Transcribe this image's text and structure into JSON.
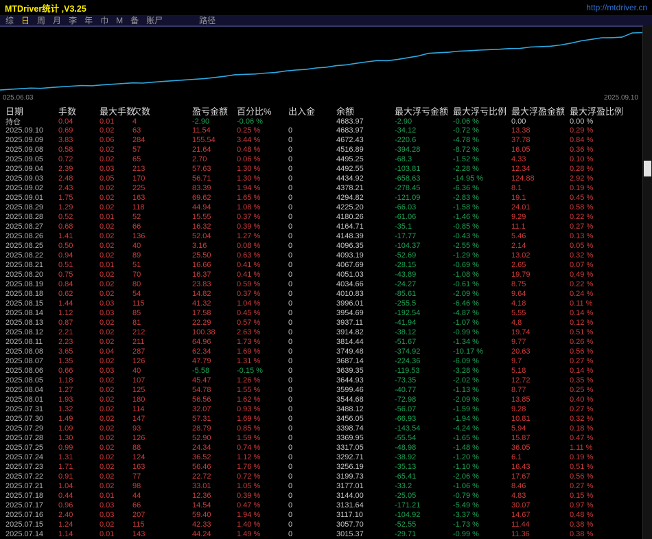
{
  "titlebar": {
    "title": "MTDriver统计 ,V3.25",
    "link": "http://mtdriver.cn"
  },
  "menu": {
    "items": [
      {
        "label": "综",
        "active": false,
        "spaced": false
      },
      {
        "label": "日",
        "active": true,
        "spaced": false
      },
      {
        "label": "周",
        "active": false,
        "spaced": false
      },
      {
        "label": "月",
        "active": false,
        "spaced": false
      },
      {
        "label": "李",
        "active": false,
        "spaced": false
      },
      {
        "label": "年",
        "active": false,
        "spaced": false
      },
      {
        "label": "巾",
        "active": false,
        "spaced": false
      },
      {
        "label": "M",
        "active": false,
        "spaced": false
      },
      {
        "label": "备",
        "active": false,
        "spaced": false
      },
      {
        "label": "账尸",
        "active": false,
        "spaced": false
      },
      {
        "label": "路径",
        "active": false,
        "spaced": true
      }
    ]
  },
  "colors": {
    "red": "#d03c3c",
    "green": "#1ea355",
    "white": "#c8c8c8",
    "date_gray": "#b4b4b4",
    "header": "#d6d6d6",
    "line_blue": "#2da9e1",
    "title_yellow": "#ffef00",
    "link_blue": "#2f6fd0"
  },
  "chart_data": {
    "type": "line",
    "title": "",
    "xlabel": "",
    "ylabel": "",
    "x_start_label": "025.06.03",
    "x_end_label": "2025.09.10",
    "ylim": [
      2450,
      4800
    ],
    "legend": "none",
    "grid": false,
    "estimated_prefix_count": 21,
    "series": [
      {
        "name": "余额",
        "color": "#2da9e1",
        "values": [
          2550,
          2575,
          2598,
          2620,
          2612,
          2645,
          2670,
          2692,
          2715,
          2708,
          2738,
          2765,
          2790,
          2815,
          2808,
          2840,
          2868,
          2895,
          2920,
          2948,
          2971,
          3015.37,
          3057.7,
          3117.1,
          3131.64,
          3144.0,
          3177.01,
          3199.73,
          3256.19,
          3292.71,
          3317.05,
          3369.95,
          3398.74,
          3456.05,
          3488.12,
          3544.68,
          3599.46,
          3644.93,
          3639.35,
          3687.14,
          3749.48,
          3814.44,
          3914.82,
          3937.11,
          3954.69,
          3996.01,
          4010.83,
          4034.66,
          4051.03,
          4067.69,
          4093.19,
          4096.35,
          4148.39,
          4164.71,
          4180.26,
          4225.2,
          4294.82,
          4378.21,
          4434.92,
          4492.55,
          4495.25,
          4516.89,
          4672.43,
          4683.97
        ]
      }
    ]
  },
  "table": {
    "columns": [
      "日期",
      "手数",
      "最大手数",
      "欠数",
      "盈亏金额",
      "百分比%",
      "出入金",
      "余额",
      "最大浮亏金额",
      "最大浮亏比例",
      "最大浮盈金额",
      "最大浮盈比例"
    ],
    "position_row": [
      "持仓",
      "0.04",
      "0.01",
      "4",
      "-2.90",
      "-0.06 %",
      "",
      "4683.97",
      "-2.90",
      "-0.06 %",
      "0.00",
      "0.00 %"
    ],
    "rows": [
      [
        "2025.09.10",
        "0.69",
        "0.02",
        "63",
        "11.54",
        "0.25 %",
        "0",
        "4683.97",
        "-34.12",
        "-0.72 %",
        "13.38",
        "0.29 %"
      ],
      [
        "2025.09.09",
        "3.83",
        "0.06",
        "284",
        "155.54",
        "3.44 %",
        "0",
        "4672.43",
        "-220.6",
        "-4.78 %",
        "37.78",
        "0.84 %"
      ],
      [
        "2025.09.08",
        "0.58",
        "0.02",
        "57",
        "21.64",
        "0.48 %",
        "0",
        "4516.89",
        "-394.28",
        "-8.72 %",
        "16.05",
        "0.36 %"
      ],
      [
        "2025.09.05",
        "0.72",
        "0.02",
        "65",
        "2.70",
        "0.06 %",
        "0",
        "4495.25",
        "-68.3",
        "-1.52 %",
        "4.33",
        "0.10 %"
      ],
      [
        "2025.09.04",
        "2.39",
        "0.03",
        "213",
        "57.63",
        "1.30 %",
        "0",
        "4492.55",
        "-103.81",
        "-2.28 %",
        "12.34",
        "0.28 %"
      ],
      [
        "2025.09.03",
        "2.48",
        "0.05",
        "170",
        "56.71",
        "1.30 %",
        "0",
        "4434.92",
        "-658.63",
        "-14.95 %",
        "124.88",
        "2.92 %"
      ],
      [
        "2025.09.02",
        "2.43",
        "0.02",
        "225",
        "83.39",
        "1.94 %",
        "0",
        "4378.21",
        "-278.45",
        "-6.36 %",
        "8.1",
        "0.19 %"
      ],
      [
        "2025.09.01",
        "1.75",
        "0.02",
        "163",
        "69.62",
        "1.65 %",
        "0",
        "4294.82",
        "-121.09",
        "-2.83 %",
        "19.1",
        "0.45 %"
      ],
      [
        "2025.08.29",
        "1.29",
        "0.02",
        "118",
        "44.94",
        "1.08 %",
        "0",
        "4225.20",
        "-66.03",
        "-1.58 %",
        "24.01",
        "0.58 %"
      ],
      [
        "2025.08.28",
        "0.52",
        "0.01",
        "52",
        "15.55",
        "0.37 %",
        "0",
        "4180.26",
        "-61.06",
        "-1.46 %",
        "9.29",
        "0.22 %"
      ],
      [
        "2025.08.27",
        "0.68",
        "0.02",
        "66",
        "16.32",
        "0.39 %",
        "0",
        "4164.71",
        "-35.1",
        "-0.85 %",
        "11.1",
        "0.27 %"
      ],
      [
        "2025.08.26",
        "1.41",
        "0.02",
        "136",
        "52.04",
        "1.27 %",
        "0",
        "4148.39",
        "-17.77",
        "-0.43 %",
        "5.46",
        "0.13 %"
      ],
      [
        "2025.08.25",
        "0.50",
        "0.02",
        "40",
        "3.16",
        "0.08 %",
        "0",
        "4096.35",
        "-104.37",
        "-2.55 %",
        "2.14",
        "0.05 %"
      ],
      [
        "2025.08.22",
        "0.94",
        "0.02",
        "89",
        "25.50",
        "0.63 %",
        "0",
        "4093.19",
        "-52.69",
        "-1.29 %",
        "13.02",
        "0.32 %"
      ],
      [
        "2025.08.21",
        "0.51",
        "0.01",
        "51",
        "16.66",
        "0.41 %",
        "0",
        "4067.69",
        "-28.15",
        "-0.69 %",
        "2.65",
        "0.07 %"
      ],
      [
        "2025.08.20",
        "0.75",
        "0.02",
        "70",
        "16.37",
        "0.41 %",
        "0",
        "4051.03",
        "-43.89",
        "-1.08 %",
        "19.79",
        "0.49 %"
      ],
      [
        "2025.08.19",
        "0.84",
        "0.02",
        "80",
        "23.83",
        "0.59 %",
        "0",
        "4034.66",
        "-24.27",
        "-0.61 %",
        "8.75",
        "0.22 %"
      ],
      [
        "2025.08.18",
        "0.62",
        "0.02",
        "54",
        "14.82",
        "0.37 %",
        "0",
        "4010.83",
        "-85.61",
        "-2.09 %",
        "9.64",
        "0.24 %"
      ],
      [
        "2025.08.15",
        "1.44",
        "0.03",
        "115",
        "41.32",
        "1.04 %",
        "0",
        "3996.01",
        "-255.5",
        "-6.46 %",
        "4.18",
        "0.11 %"
      ],
      [
        "2025.08.14",
        "1.12",
        "0.03",
        "85",
        "17.58",
        "0.45 %",
        "0",
        "3954.69",
        "-192.54",
        "-4.87 %",
        "5.55",
        "0.14 %"
      ],
      [
        "2025.08.13",
        "0.87",
        "0.02",
        "81",
        "22.29",
        "0.57 %",
        "0",
        "3937.11",
        "-41.94",
        "-1.07 %",
        "4.8",
        "0.12 %"
      ],
      [
        "2025.08.12",
        "2.21",
        "0.02",
        "212",
        "100.38",
        "2.63 %",
        "0",
        "3914.82",
        "-38.12",
        "-0.99 %",
        "19.74",
        "0.51 %"
      ],
      [
        "2025.08.11",
        "2.23",
        "0.02",
        "211",
        "64.96",
        "1.73 %",
        "0",
        "3814.44",
        "-51.67",
        "-1.34 %",
        "9.77",
        "0.26 %"
      ],
      [
        "2025.08.08",
        "3.65",
        "0.04",
        "287",
        "62.34",
        "1.69 %",
        "0",
        "3749.48",
        "-374.92",
        "-10.17 %",
        "20.63",
        "0.56 %"
      ],
      [
        "2025.08.07",
        "1.35",
        "0.02",
        "126",
        "47.79",
        "1.31 %",
        "0",
        "3687.14",
        "-224.36",
        "-6.09 %",
        "9.7",
        "0.27 %"
      ],
      [
        "2025.08.06",
        "0.66",
        "0.03",
        "40",
        "-5.58",
        "-0.15 %",
        "0",
        "3639.35",
        "-119.53",
        "-3.28 %",
        "5.18",
        "0.14 %"
      ],
      [
        "2025.08.05",
        "1.18",
        "0.02",
        "107",
        "45.47",
        "1.26 %",
        "0",
        "3644.93",
        "-73.35",
        "-2.02 %",
        "12.72",
        "0.35 %"
      ],
      [
        "2025.08.04",
        "1.27",
        "0.02",
        "125",
        "54.78",
        "1.55 %",
        "0",
        "3599.46",
        "-40.77",
        "-1.13 %",
        "8.77",
        "0.25 %"
      ],
      [
        "2025.08.01",
        "1.93",
        "0.02",
        "180",
        "56.56",
        "1.62 %",
        "0",
        "3544.68",
        "-72.98",
        "-2.09 %",
        "13.85",
        "0.40 %"
      ],
      [
        "2025.07.31",
        "1.32",
        "0.02",
        "114",
        "32.07",
        "0.93 %",
        "0",
        "3488.12",
        "-56.07",
        "-1.59 %",
        "9.28",
        "0.27 %"
      ],
      [
        "2025.07.30",
        "1.49",
        "0.02",
        "147",
        "57.31",
        "1.69 %",
        "0",
        "3456.05",
        "-66.93",
        "-1.94 %",
        "10.81",
        "0.32 %"
      ],
      [
        "2025.07.29",
        "1.09",
        "0.02",
        "93",
        "28.79",
        "0.85 %",
        "0",
        "3398.74",
        "-143.54",
        "-4.24 %",
        "5.94",
        "0.18 %"
      ],
      [
        "2025.07.28",
        "1.30",
        "0.02",
        "126",
        "52.90",
        "1.59 %",
        "0",
        "3369.95",
        "-55.54",
        "-1.65 %",
        "15.87",
        "0.47 %"
      ],
      [
        "2025.07.25",
        "0.99",
        "0.02",
        "88",
        "24.34",
        "0.74 %",
        "0",
        "3317.05",
        "-48.98",
        "-1.48 %",
        "36.05",
        "1.11 %"
      ],
      [
        "2025.07.24",
        "1.31",
        "0.02",
        "124",
        "36.52",
        "1.12 %",
        "0",
        "3292.71",
        "-38.92",
        "-1.20 %",
        "6.1",
        "0.19 %"
      ],
      [
        "2025.07.23",
        "1.71",
        "0.02",
        "163",
        "56.46",
        "1.76 %",
        "0",
        "3256.19",
        "-35.13",
        "-1.10 %",
        "16.43",
        "0.51 %"
      ],
      [
        "2025.07.22",
        "0.91",
        "0.02",
        "77",
        "22.72",
        "0.72 %",
        "0",
        "3199.73",
        "-65.41",
        "-2.06 %",
        "17.67",
        "0.56 %"
      ],
      [
        "2025.07.21",
        "1.04",
        "0.02",
        "98",
        "33.01",
        "1.05 %",
        "0",
        "3177.01",
        "-33.2",
        "-1.06 %",
        "8.46",
        "0.27 %"
      ],
      [
        "2025.07.18",
        "0.44",
        "0.01",
        "44",
        "12.36",
        "0.39 %",
        "0",
        "3144.00",
        "-25.05",
        "-0.79 %",
        "4.83",
        "0.15 %"
      ],
      [
        "2025.07.17",
        "0.96",
        "0.03",
        "66",
        "14.54",
        "0.47 %",
        "0",
        "3131.64",
        "-171.21",
        "-5.49 %",
        "30.07",
        "0.97 %"
      ],
      [
        "2025.07.16",
        "2.40",
        "0.03",
        "207",
        "59.40",
        "1.94 %",
        "0",
        "3117.10",
        "-104.92",
        "-3.37 %",
        "14.67",
        "0.48 %"
      ],
      [
        "2025.07.15",
        "1.24",
        "0.02",
        "115",
        "42.33",
        "1.40 %",
        "0",
        "3057.70",
        "-52.55",
        "-1.73 %",
        "11.44",
        "0.38 %"
      ],
      [
        "2025.07.14",
        "1.14",
        "0.01",
        "143",
        "44.24",
        "1.49 %",
        "0",
        "3015.37",
        "-29.71",
        "-0.99 %",
        "11.36",
        "0.38 %"
      ]
    ]
  },
  "scrollbar": {
    "visible": true
  }
}
